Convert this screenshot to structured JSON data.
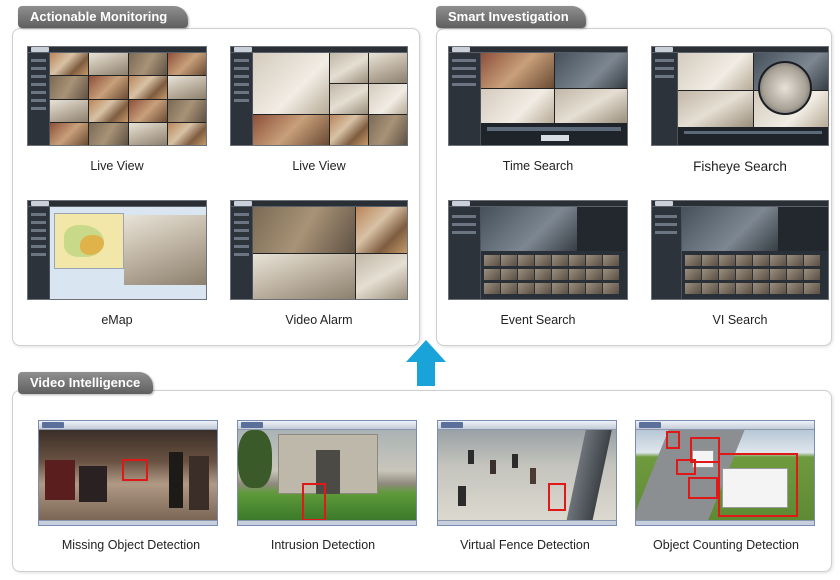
{
  "sections": {
    "monitoring": {
      "title": "Actionable Monitoring",
      "items": [
        {
          "caption": "Live View"
        },
        {
          "caption": "Live View"
        },
        {
          "caption": "eMap"
        },
        {
          "caption": "Video Alarm"
        }
      ]
    },
    "investigation": {
      "title": "Smart Investigation",
      "items": [
        {
          "caption": "Time Search"
        },
        {
          "caption": "Fisheye Search"
        },
        {
          "caption": "Event Search"
        },
        {
          "caption": "VI Search"
        }
      ]
    },
    "intelligence": {
      "title": "Video Intelligence",
      "items": [
        {
          "caption": "Missing Object Detection"
        },
        {
          "caption": "Intrusion Detection"
        },
        {
          "caption": "Virtual Fence Detection"
        },
        {
          "caption": "Object Counting Detection"
        }
      ]
    }
  },
  "colors": {
    "tab_background": "#6f6f6f",
    "arrow": "#1aa3d9",
    "detection_box": "#e01818"
  },
  "icons": {
    "flow_arrow": "arrow-up-icon"
  }
}
